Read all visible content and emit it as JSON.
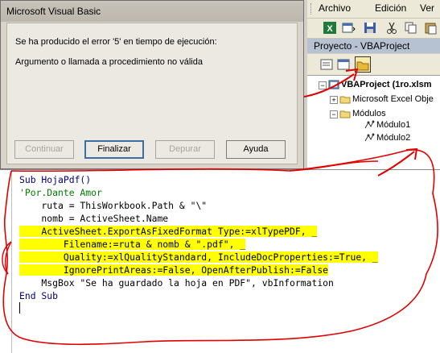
{
  "menu": {
    "items": [
      "Archivo",
      "Edición",
      "Ver"
    ]
  },
  "project": {
    "title": "Proyecto - VBAProject",
    "tree": {
      "root": "VBAProject (1ro.xlsm",
      "excel_objects": "Microsoft Excel Obje",
      "modules_folder": "Módulos",
      "modules": [
        "Módulo1",
        "Módulo2"
      ]
    }
  },
  "dialog": {
    "title": "Microsoft Visual Basic",
    "error_line": "Se ha producido el error '5' en tiempo de ejecución:",
    "error_description": "Argumento o llamada a procedimiento no válida",
    "buttons": {
      "continue": "Continuar",
      "end": "Finalizar",
      "debug": "Depurar",
      "help": "Ayuda"
    }
  },
  "code": {
    "lines": [
      "Sub HojaPdf()",
      "'Por.Dante Amor",
      "    ruta = ThisWorkbook.Path & \"\\\"",
      "    nomb = ActiveSheet.Name",
      "    ActiveSheet.ExportAsFixedFormat Type:=xlTypePDF, _",
      "        Filename:=ruta & nomb & \".pdf\", _",
      "        Quality:=xlQualityStandard, IncludeDocProperties:=True, _",
      "        IgnorePrintAreas:=False, OpenAfterPublish:=False",
      "    MsgBox \"Se ha guardado la hoja en PDF\", vbInformation",
      "End Sub"
    ]
  },
  "colors": {
    "highlight": "#ffff00",
    "annotation": "#e00000",
    "comment": "#008000"
  }
}
